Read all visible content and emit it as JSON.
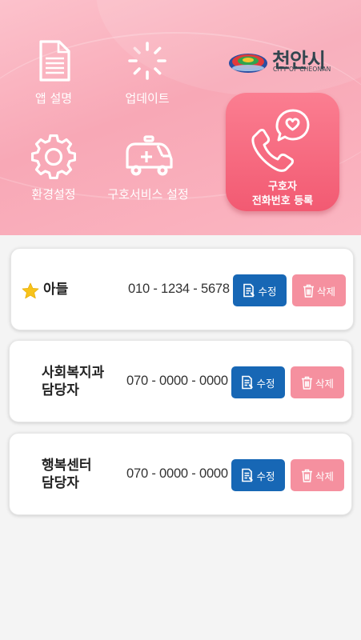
{
  "header": {
    "menu": {
      "app_guide": "앱 설명",
      "update": "업데이트",
      "settings": "환경설정",
      "rescue_service_settings": "구호서비스 설정"
    },
    "logo": {
      "name": "천안시",
      "sub": "CITY OF CHEONAN"
    },
    "register_button": {
      "line1": "구호자",
      "line2": "전화번호 등록"
    }
  },
  "contacts": [
    {
      "name_line1": "아들",
      "name_line2": "",
      "phone": "010 - 1234 - 5678",
      "favorite": true
    },
    {
      "name_line1": "사회복지과",
      "name_line2": "담당자",
      "phone": "070 - 0000 - 0000",
      "favorite": false
    },
    {
      "name_line1": "행복센터",
      "name_line2": "담당자",
      "phone": "070 - 0000 - 0000",
      "favorite": false
    }
  ],
  "actions": {
    "edit_label": "수정",
    "delete_label": "삭제"
  },
  "colors": {
    "header_pink": "#f8a8b6",
    "register_button": "#f25a72",
    "edit_button": "#1767b5",
    "delete_button": "#f5909f",
    "star": "#f7c31b"
  }
}
